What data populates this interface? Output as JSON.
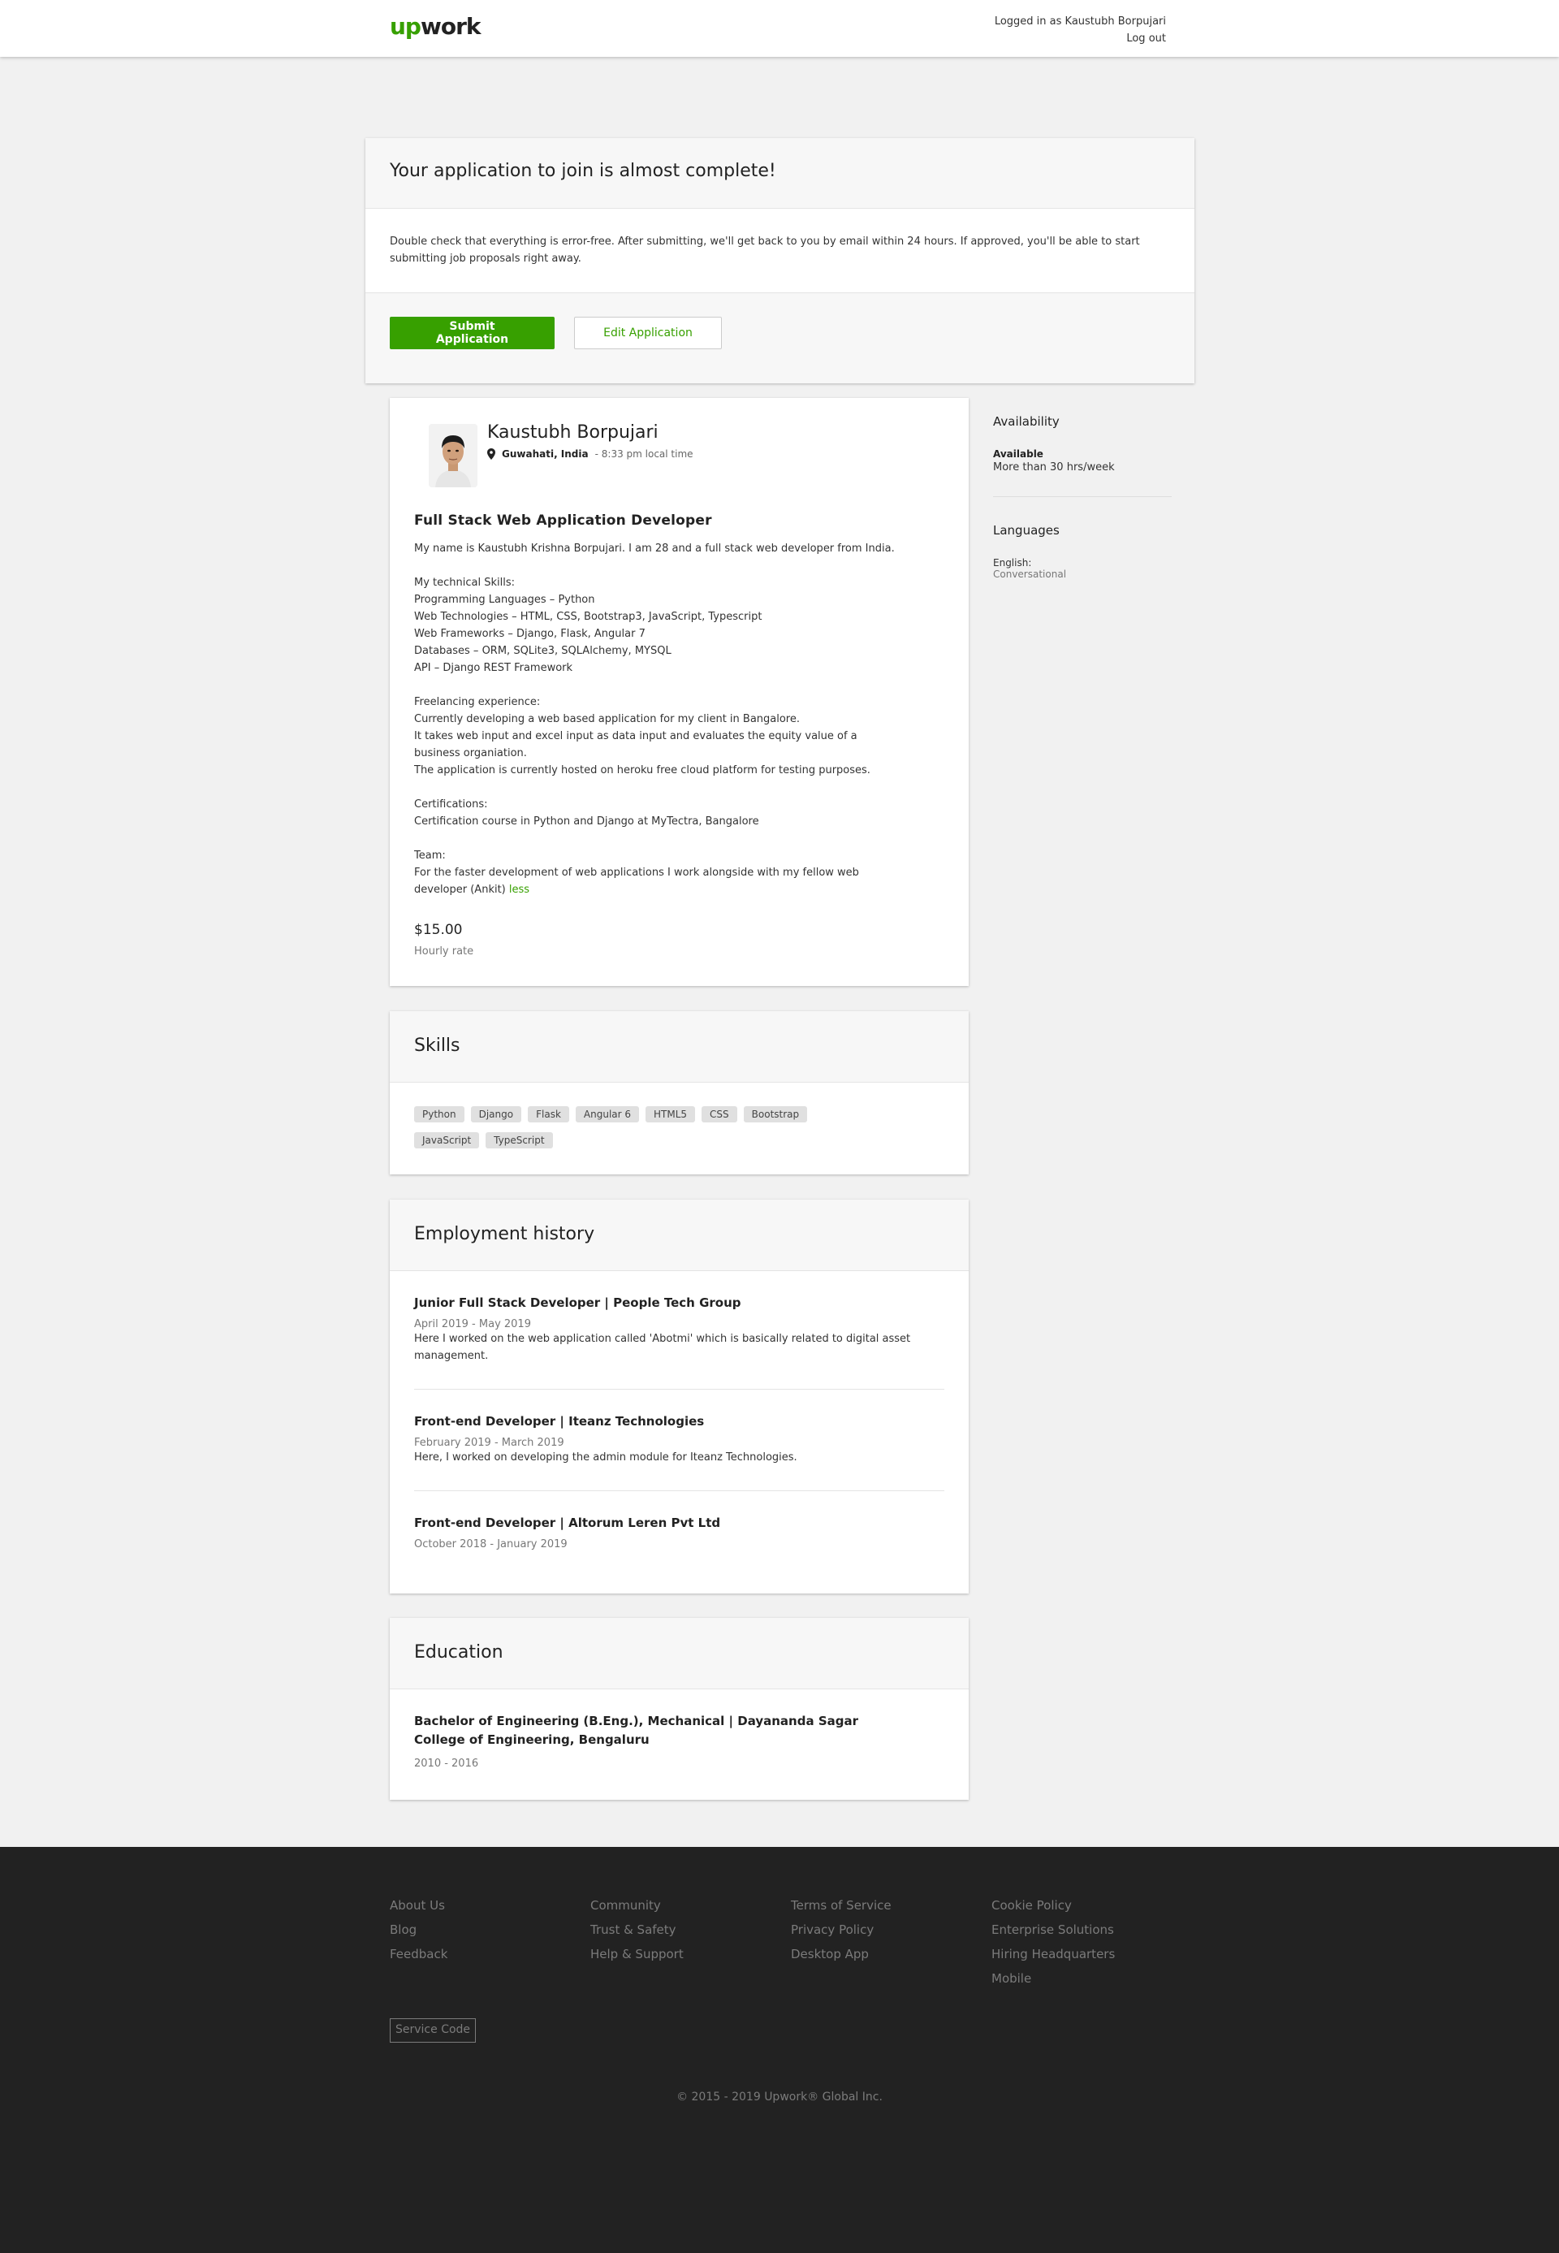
{
  "header": {
    "logo_up": "up",
    "logo_rest": "work",
    "logged_in": "Logged in as Kaustubh Borpujari",
    "logout": "Log out"
  },
  "banner": {
    "title": "Your application to join is almost complete!",
    "text": "Double check that everything is error-free. After submitting, we'll get back to you by email within 24 hours. If approved, you'll be able to start submitting job proposals right away.",
    "submit_label": "Submit Application",
    "edit_label": "Edit Application"
  },
  "profile": {
    "name": "Kaustubh Borpujari",
    "location": "Guwahati, India",
    "local_time": "- 8:33 pm local time",
    "title": "Full Stack Web Application Developer",
    "description": [
      "My name is Kaustubh Krishna Borpujari. I am 28 and a full stack web developer from India.",
      "",
      "My technical Skills:",
      "Programming Languages – Python",
      "Web Technologies – HTML, CSS, Bootstrap3, JavaScript, Typescript",
      "Web Frameworks – Django, Flask, Angular 7",
      "Databases – ORM, SQLite3, SQLAlchemy, MYSQL",
      "API – Django REST Framework",
      "",
      "Freelancing experience:",
      "Currently developing a web based application for my client in Bangalore.",
      "It takes web input and excel input as data input and evaluates the equity value of a",
      "business organiation.",
      "The application is currently hosted on heroku free cloud platform for testing purposes.",
      "",
      "Certifications:",
      "Certification course in Python and Django at MyTectra, Bangalore",
      "",
      "Team:",
      "For the faster development of web applications I work alongside with my fellow web",
      "developer (Ankit)"
    ],
    "less_link": "less",
    "rate": "$15.00",
    "rate_label": "Hourly rate"
  },
  "sidebar": {
    "availability_title": "Availability",
    "availability_status": "Available",
    "availability_hours": "More than 30 hrs/week",
    "languages_title": "Languages",
    "language_name": "English:",
    "language_level": "Conversational"
  },
  "skills": {
    "title": "Skills",
    "items": [
      "Python",
      "Django",
      "Flask",
      "Angular 6",
      "HTML5",
      "CSS",
      "Bootstrap",
      "JavaScript",
      "TypeScript"
    ]
  },
  "employment": {
    "title": "Employment history",
    "jobs": [
      {
        "title": "Junior Full Stack Developer | People Tech Group",
        "dates": "April 2019 - May 2019",
        "desc": "Here I worked on the web application called 'Abotmi' which is basically related to digital asset management."
      },
      {
        "title": "Front-end Developer | Iteanz Technologies",
        "dates": "February 2019 - March 2019",
        "desc": "Here, I worked on developing the admin module for Iteanz Technologies."
      },
      {
        "title": "Front-end Developer | Altorum Leren Pvt Ltd",
        "dates": "October 2018 - January 2019",
        "desc": ""
      }
    ]
  },
  "education": {
    "title": "Education",
    "degree": "Bachelor of Engineering (B.Eng.), Mechanical | Dayananda Sagar College of Engineering, Bengaluru",
    "years": "2010 - 2016"
  },
  "footer": {
    "columns": [
      [
        "About Us",
        "Blog",
        "Feedback"
      ],
      [
        "Community",
        "Trust & Safety",
        "Help & Support"
      ],
      [
        "Terms of Service",
        "Privacy Policy",
        "Desktop App"
      ],
      [
        "Cookie Policy",
        "Enterprise Solutions",
        "Hiring Headquarters",
        "Mobile"
      ]
    ],
    "service_code": "Service Code",
    "copyright": "© 2015 - 2019 Upwork® Global Inc."
  },
  "colors": {
    "brand_green": "#37a000",
    "footer_bg": "#222222"
  }
}
